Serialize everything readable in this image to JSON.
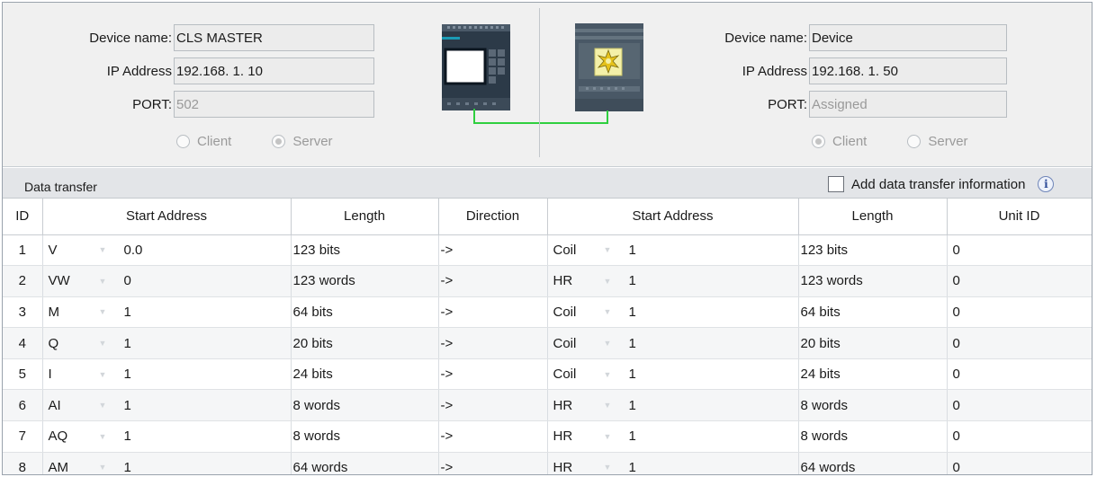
{
  "left_device": {
    "name_label": "Device name:",
    "name_value": "CLS MASTER",
    "ip_label": "IP Address",
    "ip_value": "192.168.  1. 10",
    "port_label": "PORT:",
    "port_value": "502",
    "radio_client": "Client",
    "radio_server": "Server",
    "selected_mode": "Server"
  },
  "right_device": {
    "name_label": "Device name:",
    "name_value": "Device",
    "ip_label": "IP Address",
    "ip_value": "192.168.  1. 50",
    "port_label": "PORT:",
    "port_value": "Assigned",
    "radio_client": "Client",
    "radio_server": "Server",
    "selected_mode": "Client"
  },
  "data_transfer": {
    "title": "Data transfer",
    "add_info_label": "Add data transfer information",
    "add_info_checked": false
  },
  "table": {
    "headers": [
      "ID",
      "Start Address",
      "Length",
      "Direction",
      "Start Address",
      "Length",
      "Unit ID"
    ],
    "rows": [
      {
        "id": "1",
        "src_type": "V",
        "src_addr": "0.0",
        "src_len": "123 bits",
        "dir": "->",
        "dst_type": "Coil",
        "dst_addr": "1",
        "dst_len": "123 bits",
        "unit": "0"
      },
      {
        "id": "2",
        "src_type": "VW",
        "src_addr": "0",
        "src_len": "123 words",
        "dir": "->",
        "dst_type": "HR",
        "dst_addr": "1",
        "dst_len": "123 words",
        "unit": "0"
      },
      {
        "id": "3",
        "src_type": "M",
        "src_addr": "1",
        "src_len": "64 bits",
        "dir": "->",
        "dst_type": "Coil",
        "dst_addr": "1",
        "dst_len": "64 bits",
        "unit": "0"
      },
      {
        "id": "4",
        "src_type": "Q",
        "src_addr": "1",
        "src_len": "20 bits",
        "dir": "->",
        "dst_type": "Coil",
        "dst_addr": "1",
        "dst_len": "20 bits",
        "unit": "0"
      },
      {
        "id": "5",
        "src_type": "I",
        "src_addr": "1",
        "src_len": "24 bits",
        "dir": "->",
        "dst_type": "Coil",
        "dst_addr": "1",
        "dst_len": "24 bits",
        "unit": "0"
      },
      {
        "id": "6",
        "src_type": "AI",
        "src_addr": "1",
        "src_len": "8 words",
        "dir": "->",
        "dst_type": "HR",
        "dst_addr": "1",
        "dst_len": "8 words",
        "unit": "0"
      },
      {
        "id": "7",
        "src_type": "AQ",
        "src_addr": "1",
        "src_len": "8 words",
        "dir": "->",
        "dst_type": "HR",
        "dst_addr": "1",
        "dst_len": "8 words",
        "unit": "0"
      },
      {
        "id": "8",
        "src_type": "AM",
        "src_addr": "1",
        "src_len": "64 words",
        "dir": "->",
        "dst_type": "HR",
        "dst_addr": "1",
        "dst_len": "64 words",
        "unit": "0"
      }
    ]
  },
  "icons": {
    "plc": "plc-device-icon",
    "generic_device": "modbus-device-icon",
    "dropdown": "dropdown-arrow-icon",
    "info": "info-icon"
  },
  "colors": {
    "connection_line": "#2fcf3f",
    "panel_bg": "#f0f0f0"
  }
}
